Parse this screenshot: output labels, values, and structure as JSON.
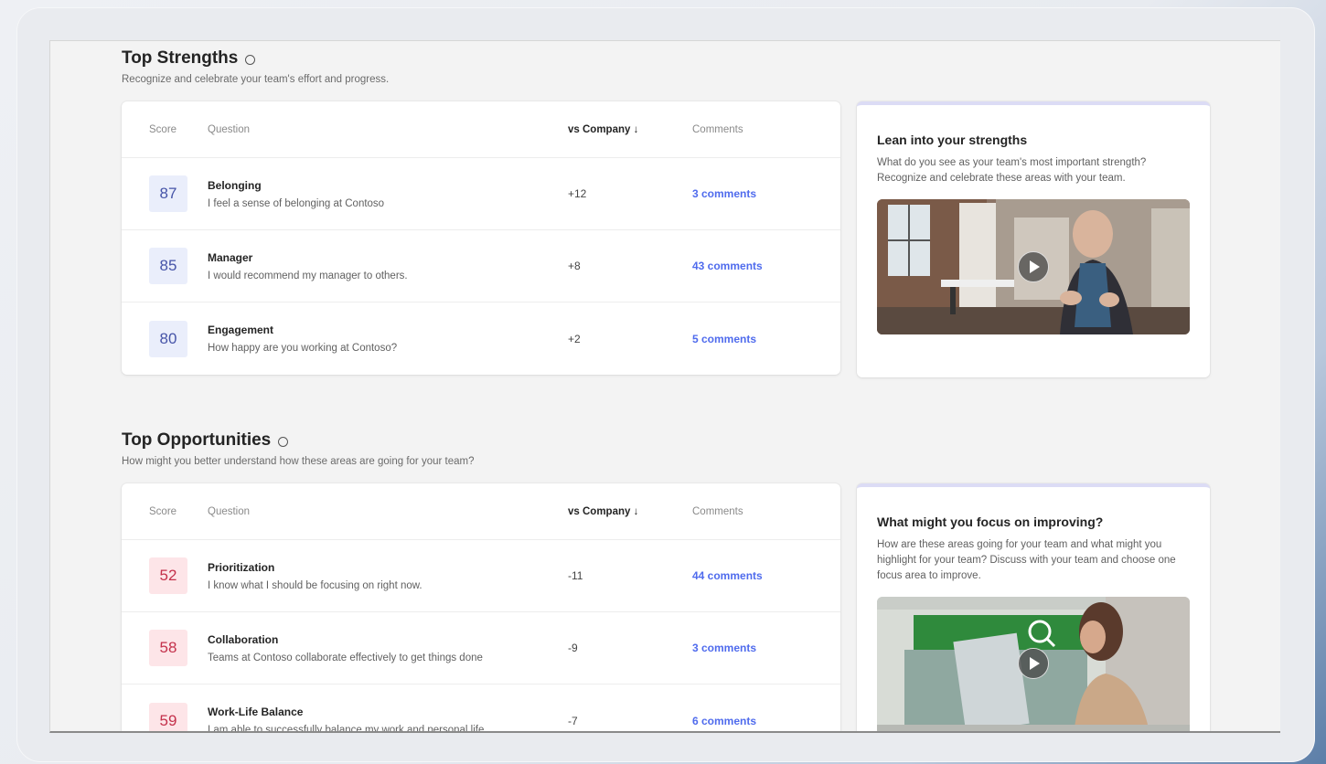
{
  "strengths": {
    "title": "Top Strengths",
    "subtitle": "Recognize and celebrate your team's effort and progress.",
    "table_headers": {
      "score": "Score",
      "question": "Question",
      "vs": "vs Company ↓",
      "comments": "Comments"
    },
    "rows": [
      {
        "score": "87",
        "title": "Belonging",
        "question": "I feel a sense of belonging at Contoso",
        "vs": "+12",
        "comments": "3 comments"
      },
      {
        "score": "85",
        "title": "Manager",
        "question": "I would recommend my manager to others.",
        "vs": "+8",
        "comments": "43 comments"
      },
      {
        "score": "80",
        "title": "Engagement",
        "question": "How happy are you working at Contoso?",
        "vs": "+2",
        "comments": "5 comments"
      }
    ],
    "side": {
      "title": "Lean into your strengths",
      "text": "What do you see as your team's most important strength? Recognize and celebrate these areas with your team."
    }
  },
  "opportunities": {
    "title": "Top Opportunities",
    "subtitle": "How might you better understand how these areas are going for your team?",
    "table_headers": {
      "score": "Score",
      "question": "Question",
      "vs": "vs Company ↓",
      "comments": "Comments"
    },
    "rows": [
      {
        "score": "52",
        "title": "Prioritization",
        "question": "I know what I should be focusing on right now.",
        "vs": "-11",
        "comments": "44 comments"
      },
      {
        "score": "58",
        "title": "Collaboration",
        "question": "Teams at Contoso collaborate effectively to get things done",
        "vs": "-9",
        "comments": "3 comments"
      },
      {
        "score": "59",
        "title": "Work-Life Balance",
        "question": "I am able to successfully balance my work and personal life",
        "vs": "-7",
        "comments": "6 comments"
      }
    ],
    "side": {
      "title": "What might you focus on improving?",
      "text": "How are these areas going for your team and what might you highlight for your team? Discuss with your team and choose one focus area to improve."
    }
  },
  "colors": {
    "accent": "#4f6bed",
    "positive_bg": "#eaeefb",
    "negative_bg": "#fde5e8"
  }
}
